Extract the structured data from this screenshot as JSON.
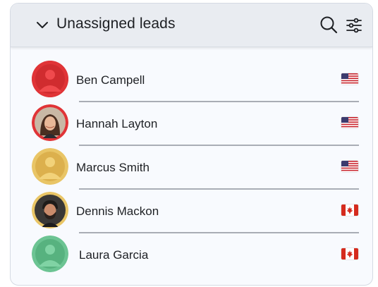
{
  "header": {
    "title": "Unassigned leads",
    "icons": [
      "chevron-down-icon",
      "search-icon",
      "filter-sliders-icon"
    ]
  },
  "leads": [
    {
      "name": "Ben Campell",
      "country": "US",
      "avatar": "placeholder",
      "avatar_color": "#e03437",
      "avatar_fg": "#c8282b"
    },
    {
      "name": "Hannah Layton",
      "country": "US",
      "avatar": "photo",
      "avatar_color": "#e03437"
    },
    {
      "name": "Marcus Smith",
      "country": "US",
      "avatar": "placeholder",
      "avatar_color": "#e9c566",
      "avatar_fg": "#d7ad45"
    },
    {
      "name": "Dennis Mackon",
      "country": "CA",
      "avatar": "photo",
      "avatar_color": "#e9c566"
    },
    {
      "name": "Laura Garcia",
      "country": "CA",
      "avatar": "placeholder",
      "avatar_color": "#6cc493",
      "avatar_fg": "#4fae7b"
    }
  ]
}
